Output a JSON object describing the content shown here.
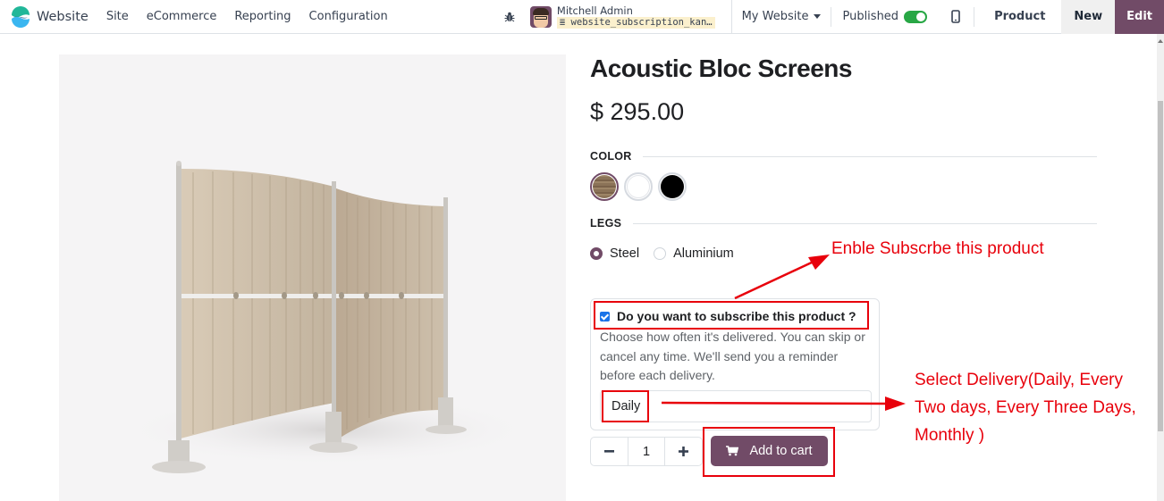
{
  "navbar": {
    "app_name": "Website",
    "menu": [
      {
        "label": "Site"
      },
      {
        "label": "eCommerce"
      },
      {
        "label": "Reporting"
      },
      {
        "label": "Configuration"
      }
    ],
    "user_name": "Mitchell Admin",
    "database": "website_subscription_kan…",
    "website_selector": "My Website",
    "published_label": "Published",
    "published": true,
    "product_label": "Product",
    "new_label": "New",
    "edit_label": "Edit"
  },
  "product": {
    "name": "Acoustic Bloc Screens",
    "price": "$ 295.00",
    "attributes": {
      "color": {
        "label": "COLOR",
        "options": [
          {
            "name": "wood",
            "color": "#8b7358",
            "selected": true
          },
          {
            "name": "white",
            "color": "#ffffff",
            "selected": false
          },
          {
            "name": "black",
            "color": "#000000",
            "selected": false
          }
        ]
      },
      "legs": {
        "label": "LEGS",
        "options": [
          {
            "label": "Steel",
            "selected": true
          },
          {
            "label": "Aluminium",
            "selected": false
          }
        ]
      }
    },
    "subscription": {
      "checked": true,
      "question": "Do you want to subscribe this product ?",
      "description": "Choose how often it's delivered. You can skip or cancel any time. We'll send you a reminder before each delivery.",
      "frequency": "Daily"
    },
    "quantity": "1",
    "add_to_cart": "Add to cart"
  },
  "annotations": {
    "enable_note": "Enble Subscrbe this product",
    "delivery_note_lines": [
      "Select Delivery(Daily, Every",
      "Two days, Every Three Days,",
      "Monthly )"
    ],
    "color": "#e8000b"
  },
  "colors": {
    "brand": "#714B67",
    "toggle_on": "#28a745"
  }
}
